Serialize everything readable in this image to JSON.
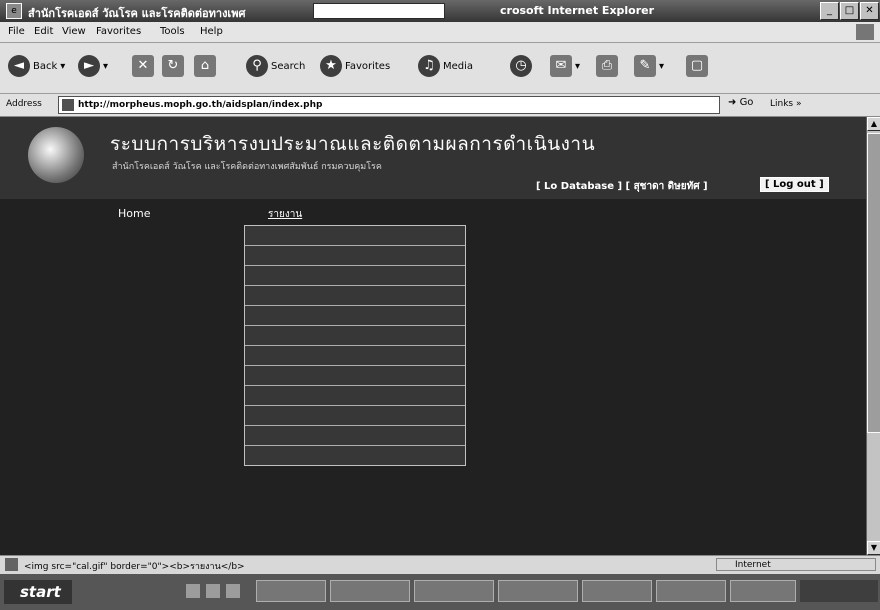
{
  "window": {
    "title": "สำนักโรคเอดส์ วัณโรค และโรคติดต่อทางเพศ",
    "title_suffix": "crosoft Internet Explorer",
    "app_icon": "ie-icon"
  },
  "menu": {
    "items": [
      "File",
      "Edit",
      "View",
      "Favorites",
      "Tools",
      "Help"
    ]
  },
  "toolbar": {
    "back": "Back",
    "search": "Search",
    "favorites": "Favorites",
    "media": "Media"
  },
  "address": {
    "label": "Address",
    "url": "http://morpheus.moph.go.th/aidsplan/index.php",
    "go": "Go",
    "links": "Links"
  },
  "page": {
    "title": "ระบบการบริหารงบประมาณและติดตามผลการดำเนินงาน",
    "subtitle": "สำนักโรคเอดส์ วัณโรค และโรคติดต่อทางเพศสัมพันธ์ กรมควบคุมโรค",
    "user_info": "[ Lo Database ] [ สุชาดา ดิษยทัศ ]",
    "logout": "[ Log out ]",
    "nav": {
      "home": "Home",
      "report": "รายงาน"
    },
    "report_items": [
      "",
      "",
      "",
      "",
      "",
      "",
      "",
      "",
      "",
      "",
      "",
      ""
    ]
  },
  "status": {
    "text": "<img src=\"cal.gif\" border=\"0\"><b>รายงาน</b>",
    "zone": "Internet"
  },
  "taskbar": {
    "start": "start",
    "tray_time": "",
    "task_count": 7
  }
}
